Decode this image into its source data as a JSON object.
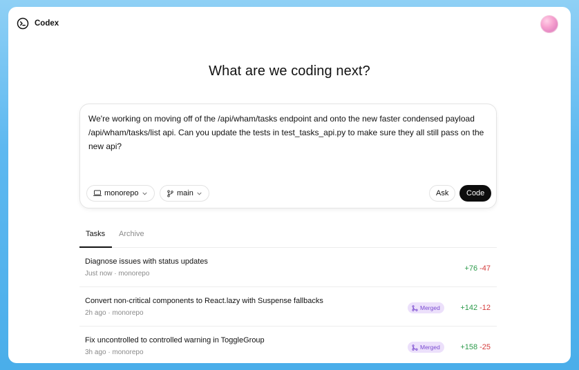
{
  "app": {
    "title": "Codex"
  },
  "headline": "What are we coding next?",
  "composer": {
    "prompt": "We're working on moving off of the /api/wham/tasks endpoint and onto the new faster condensed payload /api/wham/tasks/list api. Can you update the tests in test_tasks_api.py to make sure they all still pass on the new api?",
    "repo": "monorepo",
    "branch": "main",
    "ask_label": "Ask",
    "code_label": "Code"
  },
  "tabs": [
    {
      "label": "Tasks",
      "active": true
    },
    {
      "label": "Archive",
      "active": false
    }
  ],
  "tasks": [
    {
      "title": "Diagnose issues with status updates",
      "meta": "Just now · monorepo",
      "badge": "",
      "additions": "+76",
      "deletions": "-47"
    },
    {
      "title": "Convert non-critical components to React.lazy with Suspense fallbacks",
      "meta": "2h ago · monorepo",
      "badge": "Merged",
      "additions": "+142",
      "deletions": "-12"
    },
    {
      "title": "Fix uncontrolled to controlled warning in ToggleGroup",
      "meta": "3h ago · monorepo",
      "badge": "Merged",
      "additions": "+158",
      "deletions": "-25"
    }
  ],
  "colors": {
    "accent": "#0d0d0d",
    "badge_bg": "#ece0fb",
    "badge_text": "#7a4bd0",
    "additions": "#2b9a4a",
    "deletions": "#d43b3b"
  },
  "icons": {
    "logo": "terminal-prompt-icon",
    "repo": "laptop-icon",
    "branch": "git-branch-icon",
    "merged": "git-merge-icon",
    "chevron": "chevron-down-icon"
  }
}
